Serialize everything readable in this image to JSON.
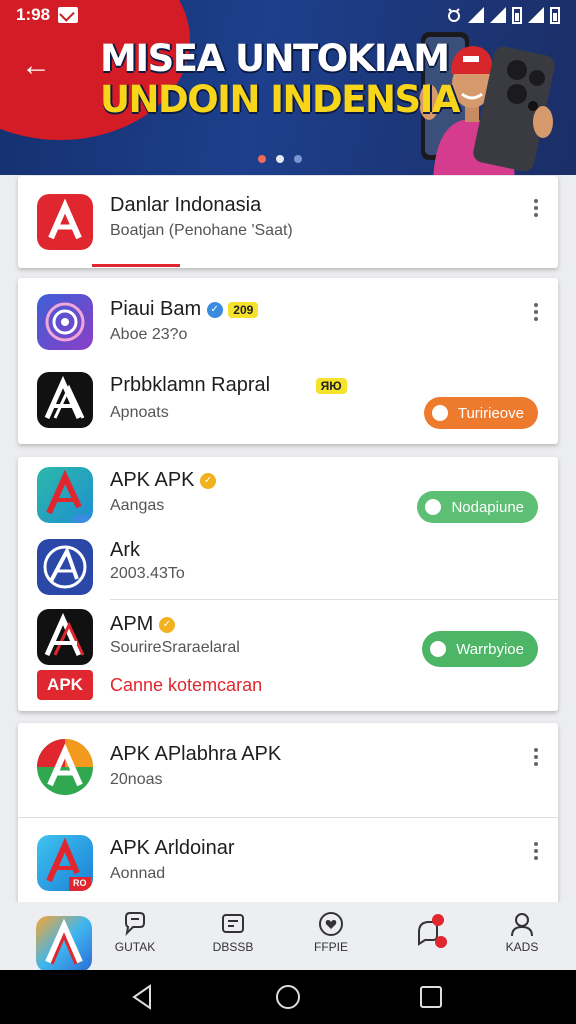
{
  "status_bar": {
    "time": "1:98"
  },
  "banner": {
    "headline_line1": "MISEA UNTOKIAM",
    "headline_line2": "UNDOIN INDENSIA",
    "colors": {
      "red": "#d31c25",
      "navy": "#14306e",
      "yellow": "#f7d51a"
    }
  },
  "cards": {
    "card1": {
      "title": "Danlar Indonasia",
      "subtitle": "Boatjan (Penohane 'Saat)"
    },
    "card2": {
      "item1": {
        "title": "Piaui Bam",
        "tag": "209",
        "subtitle": "Aboe 23?o"
      },
      "item2": {
        "title": "Prbbklamn Rapral",
        "tag": "ЯЮ",
        "subtitle": "Apnoats",
        "button": "Turirieove"
      }
    },
    "card3": {
      "item1": {
        "title": "APK APK",
        "subtitle": "Aangas",
        "button": "Nodapiune"
      },
      "item2": {
        "title": "Ark",
        "subtitle": "2003.43To"
      },
      "item3": {
        "title": "APM",
        "subtitle": "SourireSraraelaral",
        "button": "Warrbyioe"
      },
      "badge": "APK",
      "link": "Canne kotemcaran"
    },
    "card4": {
      "item1": {
        "title": "APK APlabhra APK",
        "subtitle": "20noas"
      },
      "item2": {
        "title": "APK Arldoinar",
        "subtitle": "Aonnad",
        "icon_tag": "RO"
      }
    }
  },
  "bottom_nav": {
    "items": [
      {
        "label": "GUTAK",
        "icon": "chat-icon"
      },
      {
        "label": "DBSSB",
        "icon": "tv-icon"
      },
      {
        "label": "FFPIE",
        "icon": "heart-icon"
      },
      {
        "label": "",
        "icon": "notification-icon"
      },
      {
        "label": "KADS",
        "icon": "profile-icon"
      }
    ]
  },
  "accent_colors": {
    "orange": "#ee7a2e",
    "green": "#5cbf73",
    "red": "#e0262e"
  }
}
